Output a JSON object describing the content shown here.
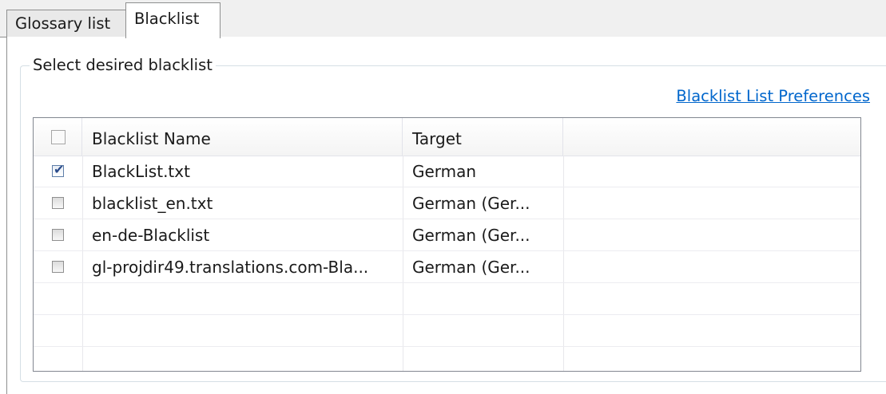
{
  "tabs": [
    {
      "label": "Glossary list",
      "active": false
    },
    {
      "label": "Blacklist",
      "active": true
    }
  ],
  "group": {
    "legend": "Select desired blacklist",
    "preferences_link": "Blacklist List Preferences"
  },
  "table": {
    "columns": [
      "",
      "Blacklist Name",
      "Target",
      ""
    ],
    "header_checked": false,
    "rows": [
      {
        "checked": true,
        "name": "BlackList.txt",
        "target": "German"
      },
      {
        "checked": false,
        "name": "blacklist_en.txt",
        "target": "German (Ger..."
      },
      {
        "checked": false,
        "name": "en-de-Blacklist",
        "target": "German (Ger..."
      },
      {
        "checked": false,
        "name": "gl-projdir49.translations.com-Bla...",
        "target": "German (Ger..."
      }
    ]
  },
  "colors": {
    "link": "#0066cc",
    "check": "#2a4b8a",
    "border": "#828790"
  }
}
